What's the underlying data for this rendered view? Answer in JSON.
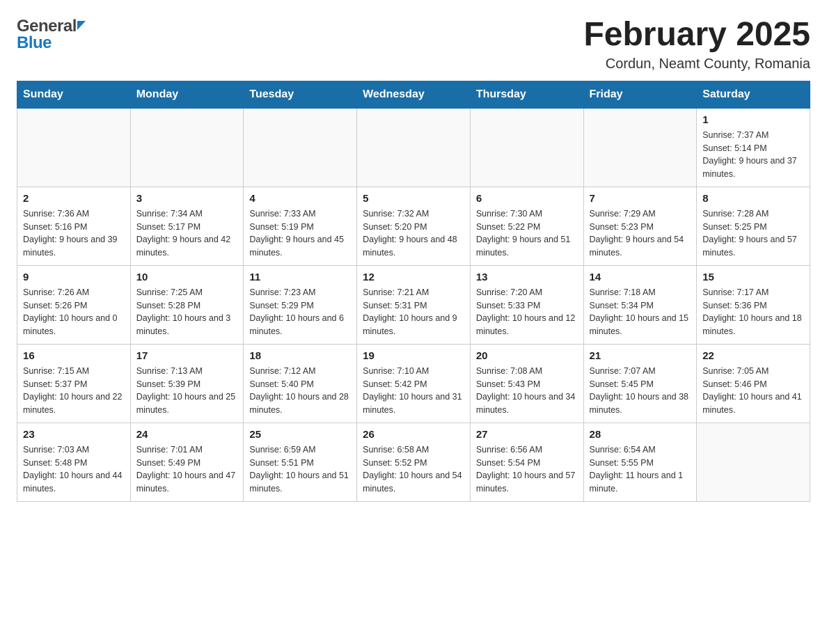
{
  "header": {
    "title": "February 2025",
    "subtitle": "Cordun, Neamt County, Romania",
    "logo_general": "General",
    "logo_blue": "Blue"
  },
  "weekdays": [
    "Sunday",
    "Monday",
    "Tuesday",
    "Wednesday",
    "Thursday",
    "Friday",
    "Saturday"
  ],
  "weeks": [
    [
      {
        "day": "",
        "info": ""
      },
      {
        "day": "",
        "info": ""
      },
      {
        "day": "",
        "info": ""
      },
      {
        "day": "",
        "info": ""
      },
      {
        "day": "",
        "info": ""
      },
      {
        "day": "",
        "info": ""
      },
      {
        "day": "1",
        "info": "Sunrise: 7:37 AM\nSunset: 5:14 PM\nDaylight: 9 hours and 37 minutes."
      }
    ],
    [
      {
        "day": "2",
        "info": "Sunrise: 7:36 AM\nSunset: 5:16 PM\nDaylight: 9 hours and 39 minutes."
      },
      {
        "day": "3",
        "info": "Sunrise: 7:34 AM\nSunset: 5:17 PM\nDaylight: 9 hours and 42 minutes."
      },
      {
        "day": "4",
        "info": "Sunrise: 7:33 AM\nSunset: 5:19 PM\nDaylight: 9 hours and 45 minutes."
      },
      {
        "day": "5",
        "info": "Sunrise: 7:32 AM\nSunset: 5:20 PM\nDaylight: 9 hours and 48 minutes."
      },
      {
        "day": "6",
        "info": "Sunrise: 7:30 AM\nSunset: 5:22 PM\nDaylight: 9 hours and 51 minutes."
      },
      {
        "day": "7",
        "info": "Sunrise: 7:29 AM\nSunset: 5:23 PM\nDaylight: 9 hours and 54 minutes."
      },
      {
        "day": "8",
        "info": "Sunrise: 7:28 AM\nSunset: 5:25 PM\nDaylight: 9 hours and 57 minutes."
      }
    ],
    [
      {
        "day": "9",
        "info": "Sunrise: 7:26 AM\nSunset: 5:26 PM\nDaylight: 10 hours and 0 minutes."
      },
      {
        "day": "10",
        "info": "Sunrise: 7:25 AM\nSunset: 5:28 PM\nDaylight: 10 hours and 3 minutes."
      },
      {
        "day": "11",
        "info": "Sunrise: 7:23 AM\nSunset: 5:29 PM\nDaylight: 10 hours and 6 minutes."
      },
      {
        "day": "12",
        "info": "Sunrise: 7:21 AM\nSunset: 5:31 PM\nDaylight: 10 hours and 9 minutes."
      },
      {
        "day": "13",
        "info": "Sunrise: 7:20 AM\nSunset: 5:33 PM\nDaylight: 10 hours and 12 minutes."
      },
      {
        "day": "14",
        "info": "Sunrise: 7:18 AM\nSunset: 5:34 PM\nDaylight: 10 hours and 15 minutes."
      },
      {
        "day": "15",
        "info": "Sunrise: 7:17 AM\nSunset: 5:36 PM\nDaylight: 10 hours and 18 minutes."
      }
    ],
    [
      {
        "day": "16",
        "info": "Sunrise: 7:15 AM\nSunset: 5:37 PM\nDaylight: 10 hours and 22 minutes."
      },
      {
        "day": "17",
        "info": "Sunrise: 7:13 AM\nSunset: 5:39 PM\nDaylight: 10 hours and 25 minutes."
      },
      {
        "day": "18",
        "info": "Sunrise: 7:12 AM\nSunset: 5:40 PM\nDaylight: 10 hours and 28 minutes."
      },
      {
        "day": "19",
        "info": "Sunrise: 7:10 AM\nSunset: 5:42 PM\nDaylight: 10 hours and 31 minutes."
      },
      {
        "day": "20",
        "info": "Sunrise: 7:08 AM\nSunset: 5:43 PM\nDaylight: 10 hours and 34 minutes."
      },
      {
        "day": "21",
        "info": "Sunrise: 7:07 AM\nSunset: 5:45 PM\nDaylight: 10 hours and 38 minutes."
      },
      {
        "day": "22",
        "info": "Sunrise: 7:05 AM\nSunset: 5:46 PM\nDaylight: 10 hours and 41 minutes."
      }
    ],
    [
      {
        "day": "23",
        "info": "Sunrise: 7:03 AM\nSunset: 5:48 PM\nDaylight: 10 hours and 44 minutes."
      },
      {
        "day": "24",
        "info": "Sunrise: 7:01 AM\nSunset: 5:49 PM\nDaylight: 10 hours and 47 minutes."
      },
      {
        "day": "25",
        "info": "Sunrise: 6:59 AM\nSunset: 5:51 PM\nDaylight: 10 hours and 51 minutes."
      },
      {
        "day": "26",
        "info": "Sunrise: 6:58 AM\nSunset: 5:52 PM\nDaylight: 10 hours and 54 minutes."
      },
      {
        "day": "27",
        "info": "Sunrise: 6:56 AM\nSunset: 5:54 PM\nDaylight: 10 hours and 57 minutes."
      },
      {
        "day": "28",
        "info": "Sunrise: 6:54 AM\nSunset: 5:55 PM\nDaylight: 11 hours and 1 minute."
      },
      {
        "day": "",
        "info": ""
      }
    ]
  ]
}
